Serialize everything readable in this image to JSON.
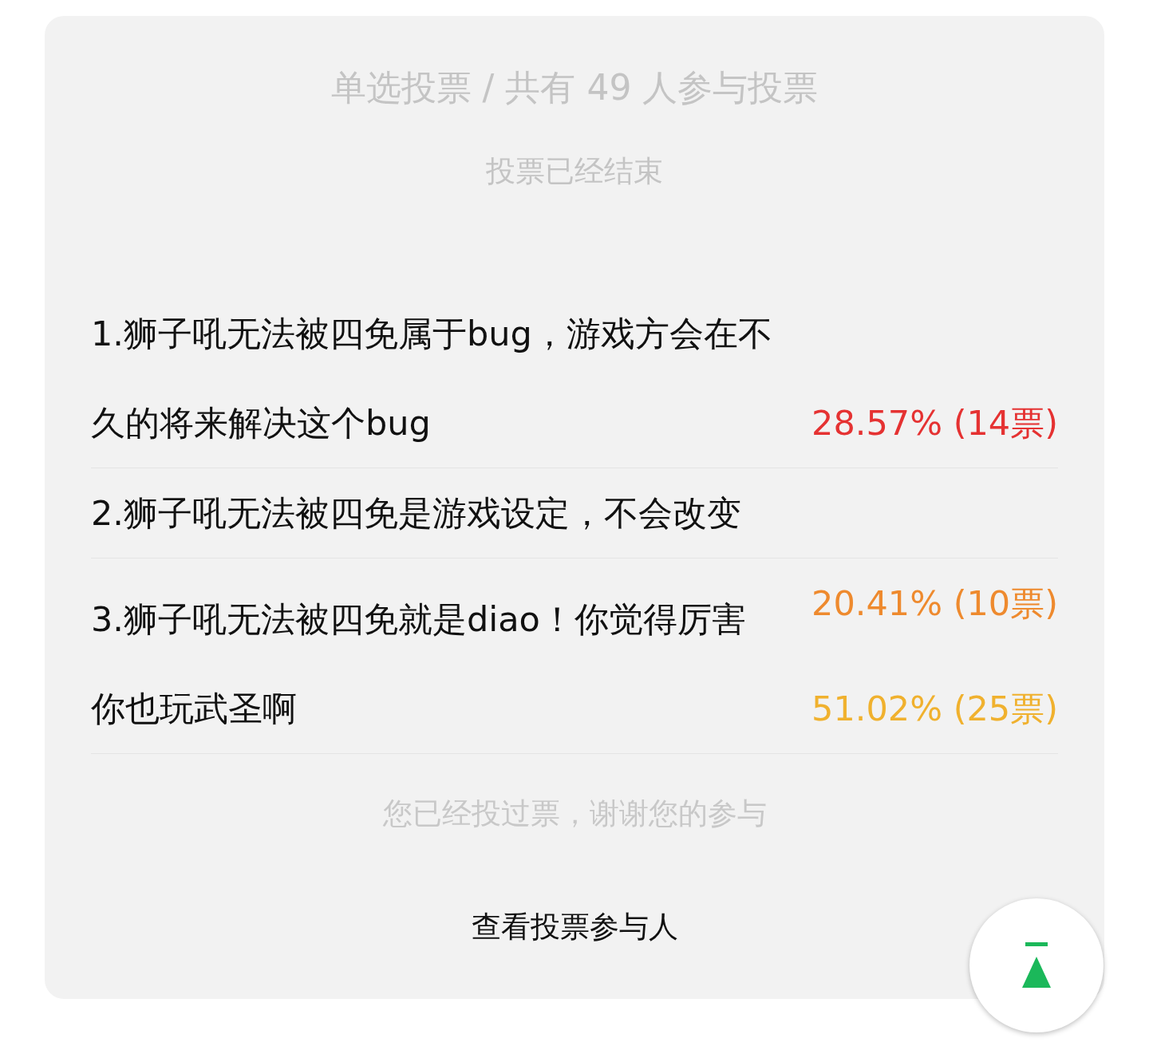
{
  "poll": {
    "title": "单选投票 / 共有 49 人参与投票",
    "status": "投票已经结束",
    "options": [
      {
        "text": "1.狮子吼无法被四免属于bug，游戏方会在不久的将来解决这个bug",
        "results": [
          {
            "text": "28.57% (14票)",
            "color": "#e53232"
          }
        ]
      },
      {
        "text": "2.狮子吼无法被四免是游戏设定，不会改变"
      },
      {
        "text": "3.狮子吼无法被四免就是diao！你觉得厉害你也玩武圣啊",
        "results": [
          {
            "text": "20.41% (10票)",
            "color": "#ee8a2e"
          },
          {
            "text": "51.02% (25票)",
            "color": "#f0b12e"
          }
        ]
      }
    ],
    "note": "您已经投过票，谢谢您的参与",
    "participants_button": "查看投票参与人"
  }
}
